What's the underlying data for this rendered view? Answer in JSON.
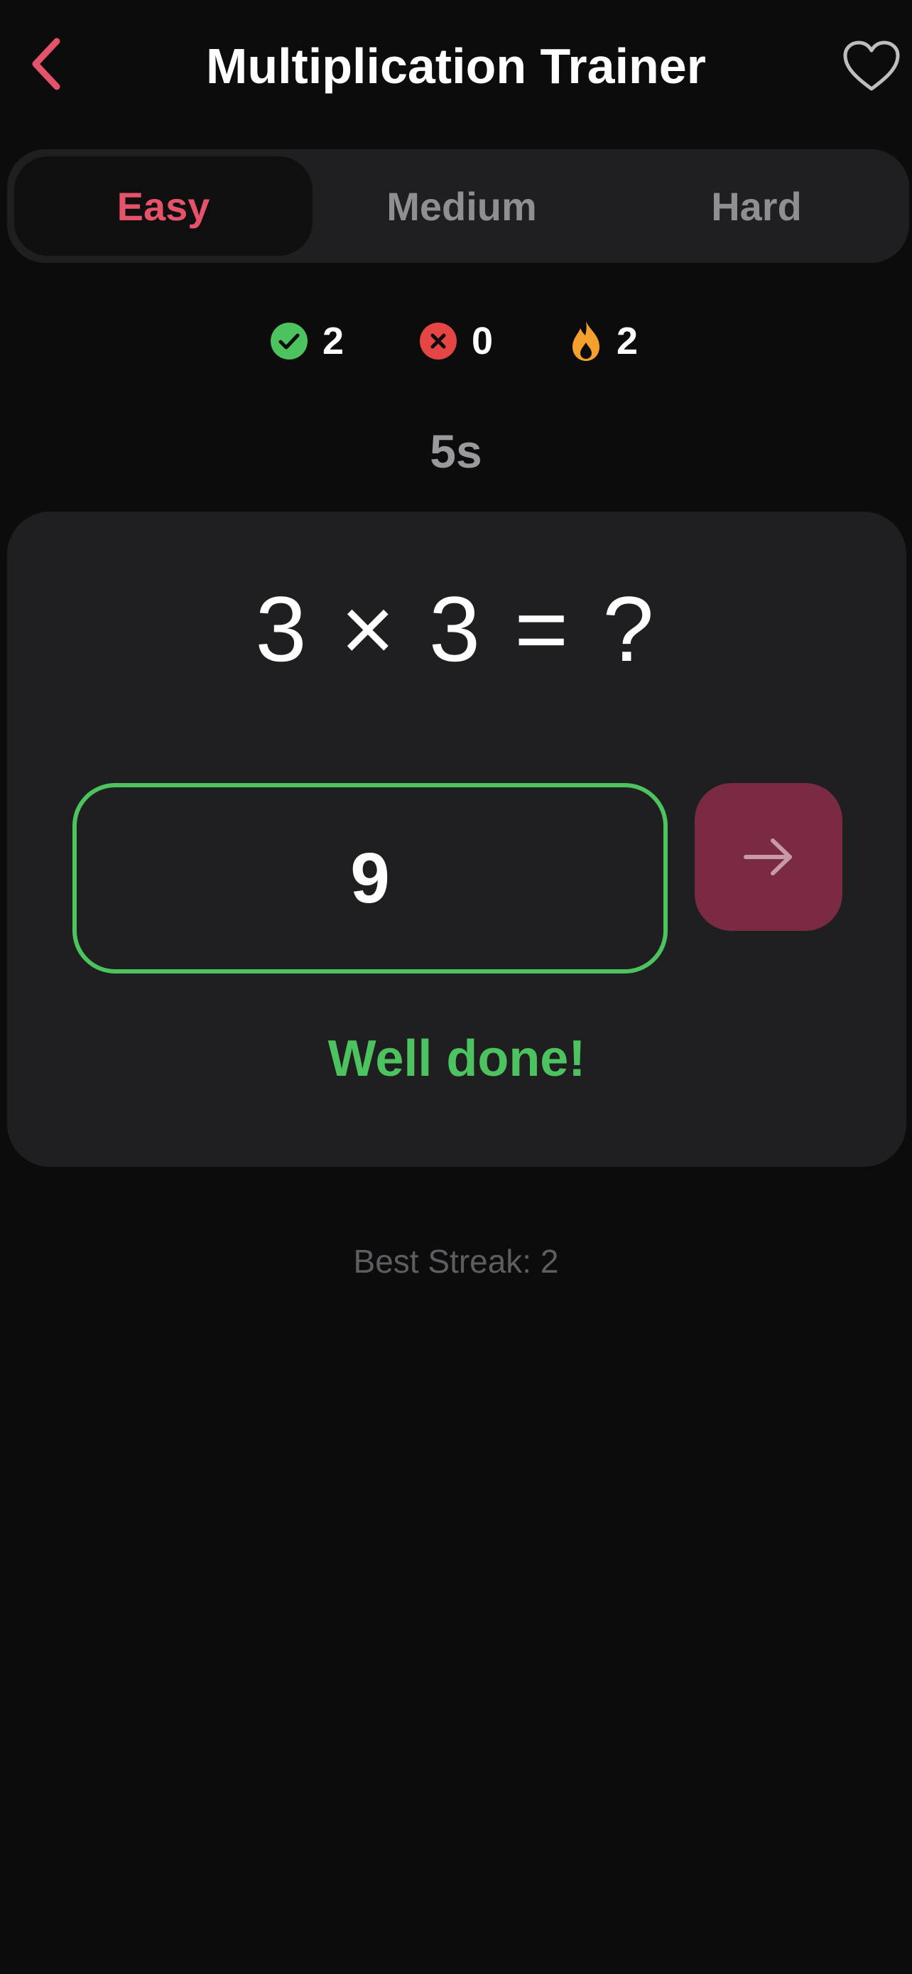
{
  "header": {
    "title": "Multiplication Trainer",
    "back_icon": "chevron-left-icon",
    "favorite_icon": "heart-outline-icon"
  },
  "difficulty": {
    "options": [
      "Easy",
      "Medium",
      "Hard"
    ],
    "selected": "Easy"
  },
  "stats": {
    "correct": "2",
    "wrong": "0",
    "streak": "2"
  },
  "timer": "5s",
  "question": {
    "text": "3 × 3 = ?"
  },
  "answer": {
    "value": "9"
  },
  "feedback": "Well done!",
  "best_streak": "Best Streak: 2",
  "colors": {
    "accent": "#e5536a",
    "success": "#4cc35f",
    "error": "#e54545",
    "streak": "#f5a02c",
    "submit_bg": "#7a2b41",
    "card_bg": "#1f1f21",
    "page_bg": "#0c0c0d"
  }
}
